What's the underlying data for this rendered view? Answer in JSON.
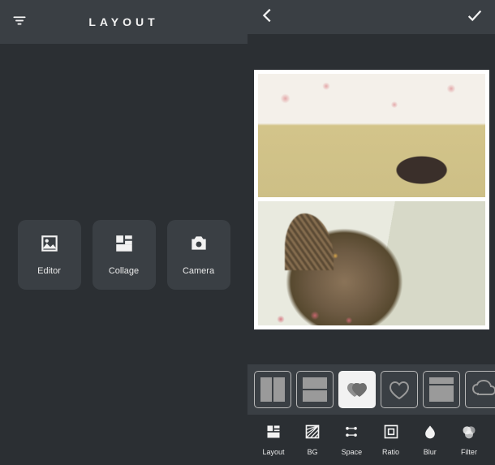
{
  "left": {
    "title": "LAYOUT",
    "tiles": {
      "editor": "Editor",
      "collage": "Collage",
      "camera": "Camera"
    }
  },
  "right": {
    "toolbar": {
      "layout": "Layout",
      "bg": "BG",
      "space": "Space",
      "ratio": "Ratio",
      "blur": "Blur",
      "filter": "Filter"
    }
  }
}
